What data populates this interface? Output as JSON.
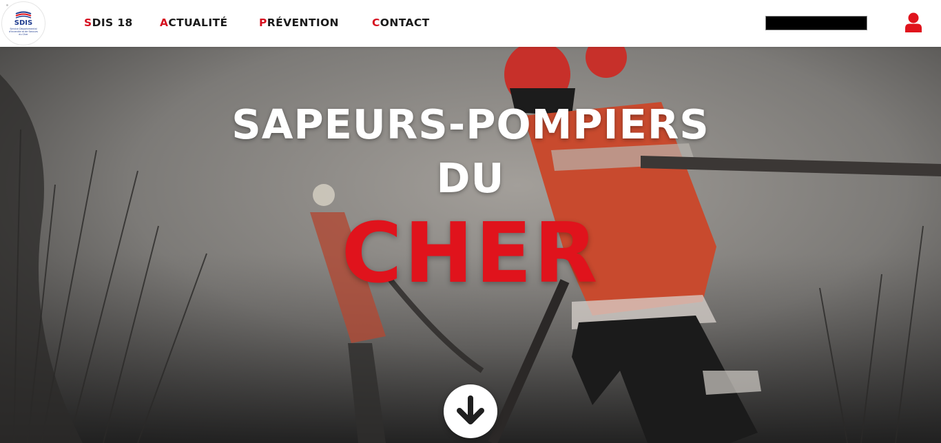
{
  "header": {
    "logo": {
      "name": "SDIS",
      "subtitle": "Service Départemental d'Incendie et de Secours du Cher"
    },
    "nav": [
      {
        "first": "S",
        "rest": "DIS 18"
      },
      {
        "first": "A",
        "rest": "CTUALITÉ"
      },
      {
        "first": "P",
        "rest": "RÉVENTION"
      },
      {
        "first": "C",
        "rest": "ONTACT"
      }
    ],
    "search": {
      "value": "",
      "placeholder": ""
    },
    "user_icon": "user-icon"
  },
  "hero": {
    "line1": "SAPEURS-POMPIERS",
    "line2": "DU",
    "line3": "CHER",
    "scroll_icon": "arrow-down-icon"
  },
  "colors": {
    "accent_red": "#d6101f",
    "hero_red": "#e0131c",
    "logo_blue": "#1f3c8f"
  }
}
